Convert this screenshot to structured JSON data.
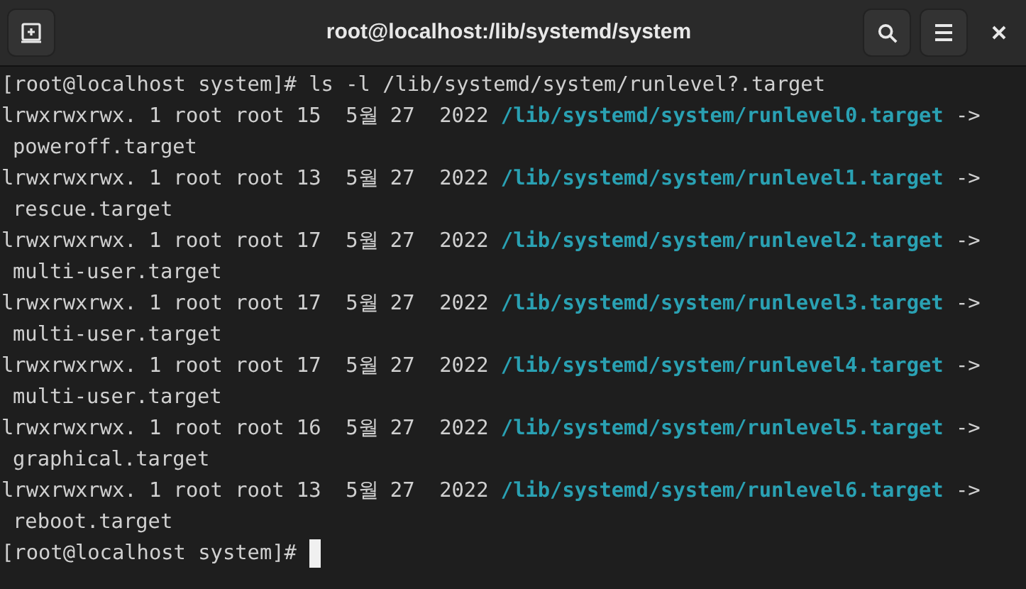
{
  "window": {
    "title": "root@localhost:/lib/systemd/system"
  },
  "terminal": {
    "command_line": {
      "prompt": "[root@localhost system]#",
      "command": "ls -l /lib/systemd/system/runlevel?.target"
    },
    "entries": [
      {
        "info": "lrwxrwxrwx. 1 root root 15  5월 27  2022",
        "path": "/lib/systemd/system/runlevel0.target",
        "arrow": "->",
        "target": "poweroff.target"
      },
      {
        "info": "lrwxrwxrwx. 1 root root 13  5월 27  2022",
        "path": "/lib/systemd/system/runlevel1.target",
        "arrow": "->",
        "target": "rescue.target"
      },
      {
        "info": "lrwxrwxrwx. 1 root root 17  5월 27  2022",
        "path": "/lib/systemd/system/runlevel2.target",
        "arrow": "->",
        "target": "multi-user.target"
      },
      {
        "info": "lrwxrwxrwx. 1 root root 17  5월 27  2022",
        "path": "/lib/systemd/system/runlevel3.target",
        "arrow": "->",
        "target": "multi-user.target"
      },
      {
        "info": "lrwxrwxrwx. 1 root root 17  5월 27  2022",
        "path": "/lib/systemd/system/runlevel4.target",
        "arrow": "->",
        "target": "multi-user.target"
      },
      {
        "info": "lrwxrwxrwx. 1 root root 16  5월 27  2022",
        "path": "/lib/systemd/system/runlevel5.target",
        "arrow": "->",
        "target": "graphical.target"
      },
      {
        "info": "lrwxrwxrwx. 1 root root 13  5월 27  2022",
        "path": "/lib/systemd/system/runlevel6.target",
        "arrow": "->",
        "target": "reboot.target"
      }
    ],
    "final_prompt": "[root@localhost system]#"
  }
}
